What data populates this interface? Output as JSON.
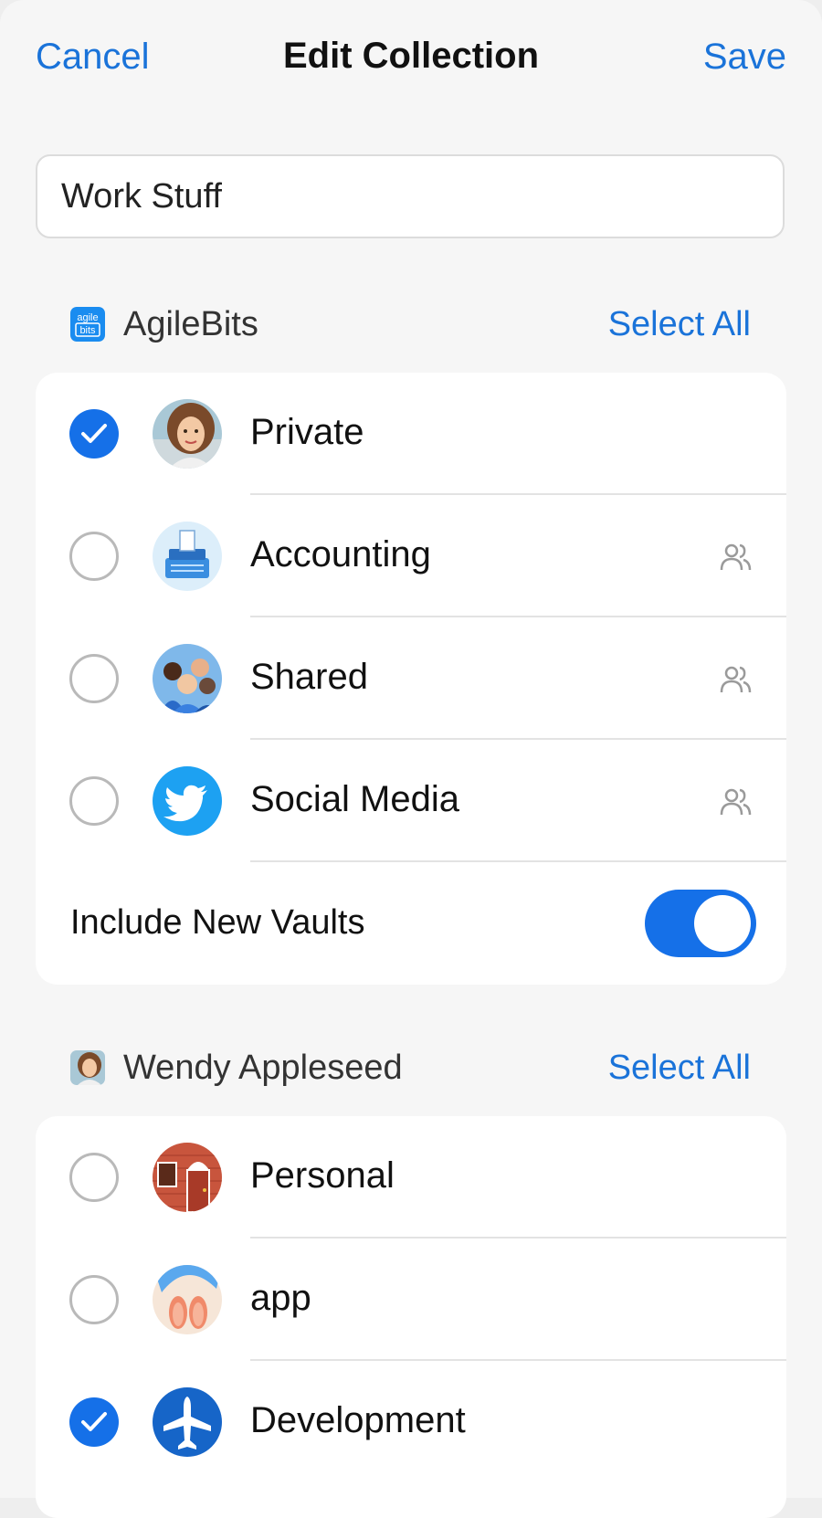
{
  "nav": {
    "cancel_label": "Cancel",
    "title": "Edit Collection",
    "save_label": "Save"
  },
  "collection_name": {
    "value": "Work Stuff"
  },
  "accounts": [
    {
      "name": "AgileBits",
      "icon": "agilebits-logo-icon",
      "select_all_label": "Select All",
      "vaults": [
        {
          "label": "Private",
          "selected": true,
          "avatar": "woman-portrait-avatar",
          "shared": false
        },
        {
          "label": "Accounting",
          "selected": false,
          "avatar": "cash-register-avatar",
          "shared": true
        },
        {
          "label": "Shared",
          "selected": false,
          "avatar": "group-people-avatar",
          "shared": true
        },
        {
          "label": "Social Media",
          "selected": false,
          "avatar": "twitter-bird-avatar",
          "shared": true
        }
      ],
      "include_new_vaults": {
        "label": "Include New Vaults",
        "enabled": true
      }
    },
    {
      "name": "Wendy Appleseed",
      "icon": "wendy-photo-icon",
      "select_all_label": "Select All",
      "vaults": [
        {
          "label": "Personal",
          "selected": false,
          "avatar": "house-door-avatar",
          "shared": false
        },
        {
          "label": "app",
          "selected": false,
          "avatar": "flip-flops-avatar",
          "shared": false
        },
        {
          "label": "Development",
          "selected": true,
          "avatar": "airplane-avatar",
          "shared": false
        }
      ]
    }
  ],
  "colors": {
    "accent": "#1570e8",
    "link": "#1a73d9",
    "background": "#f6f6f6"
  },
  "icons": {
    "shared": "people-icon",
    "check": "checkmark-icon"
  }
}
